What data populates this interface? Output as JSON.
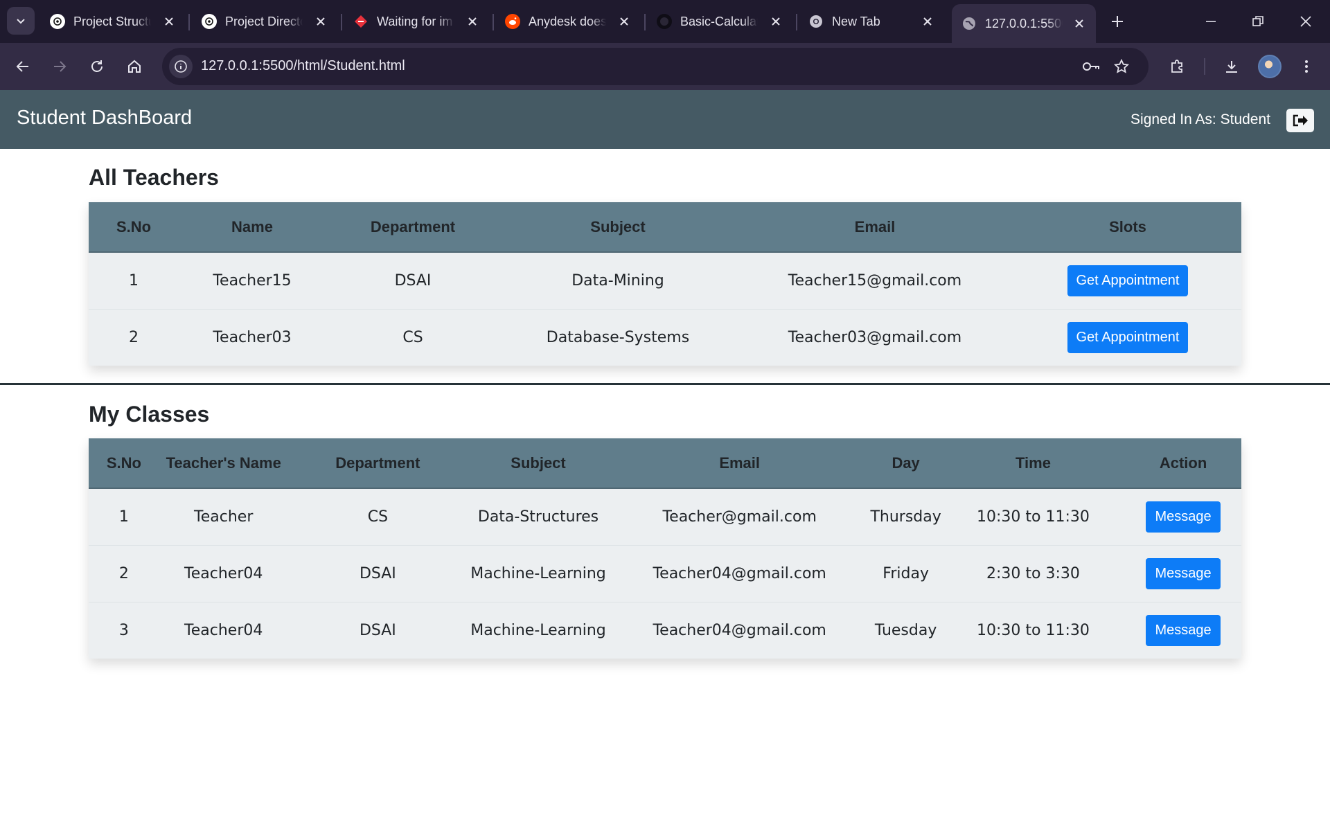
{
  "browser": {
    "tabs": [
      {
        "title": "Project Structu",
        "icon": "openai-icon"
      },
      {
        "title": "Project Directo",
        "icon": "openai-icon"
      },
      {
        "title": "Waiting for im",
        "icon": "diamond-icon"
      },
      {
        "title": "Anydesk doesn",
        "icon": "reddit-icon"
      },
      {
        "title": "Basic-Calculat",
        "icon": "github-icon"
      },
      {
        "title": "New Tab",
        "icon": "chrome-icon"
      },
      {
        "title": "127.0.0.1:5500",
        "icon": "globe-icon",
        "active": true
      }
    ],
    "url": "127.0.0.1:5500/html/Student.html"
  },
  "app": {
    "title": "Student DashBoard",
    "signed_in": "Signed In As: Student"
  },
  "teachers": {
    "heading": "All Teachers",
    "columns": [
      "S.No",
      "Name",
      "Department",
      "Subject",
      "Email",
      "Slots"
    ],
    "rows": [
      {
        "sno": "1",
        "name": "Teacher15",
        "department": "DSAI",
        "subject": "Data-Mining",
        "email": "Teacher15@gmail.com",
        "action": "Get Appointment"
      },
      {
        "sno": "2",
        "name": "Teacher03",
        "department": "CS",
        "subject": "Database-Systems",
        "email": "Teacher03@gmail.com",
        "action": "Get Appointment"
      }
    ]
  },
  "classes": {
    "heading": "My Classes",
    "columns": [
      "S.No",
      "Teacher's Name",
      "Department",
      "Subject",
      "Email",
      "Day",
      "Time",
      "Action"
    ],
    "rows": [
      {
        "sno": "1",
        "name": "Teacher",
        "department": "CS",
        "subject": "Data-Structures",
        "email": "Teacher@gmail.com",
        "day": "Thursday",
        "time": "10:30 to 11:30",
        "action": "Message"
      },
      {
        "sno": "2",
        "name": "Teacher04",
        "department": "DSAI",
        "subject": "Machine-Learning",
        "email": "Teacher04@gmail.com",
        "day": "Friday",
        "time": "2:30 to 3:30",
        "action": "Message"
      },
      {
        "sno": "3",
        "name": "Teacher04",
        "department": "DSAI",
        "subject": "Machine-Learning",
        "email": "Teacher04@gmail.com",
        "day": "Tuesday",
        "time": "10:30 to 11:30",
        "action": "Message"
      }
    ]
  },
  "colors": {
    "appbar": "#455a64",
    "table_header": "#607d8b",
    "table_body": "#eceff1",
    "button": "#0d7cf7",
    "browser_frame": "#1f1a2e"
  }
}
